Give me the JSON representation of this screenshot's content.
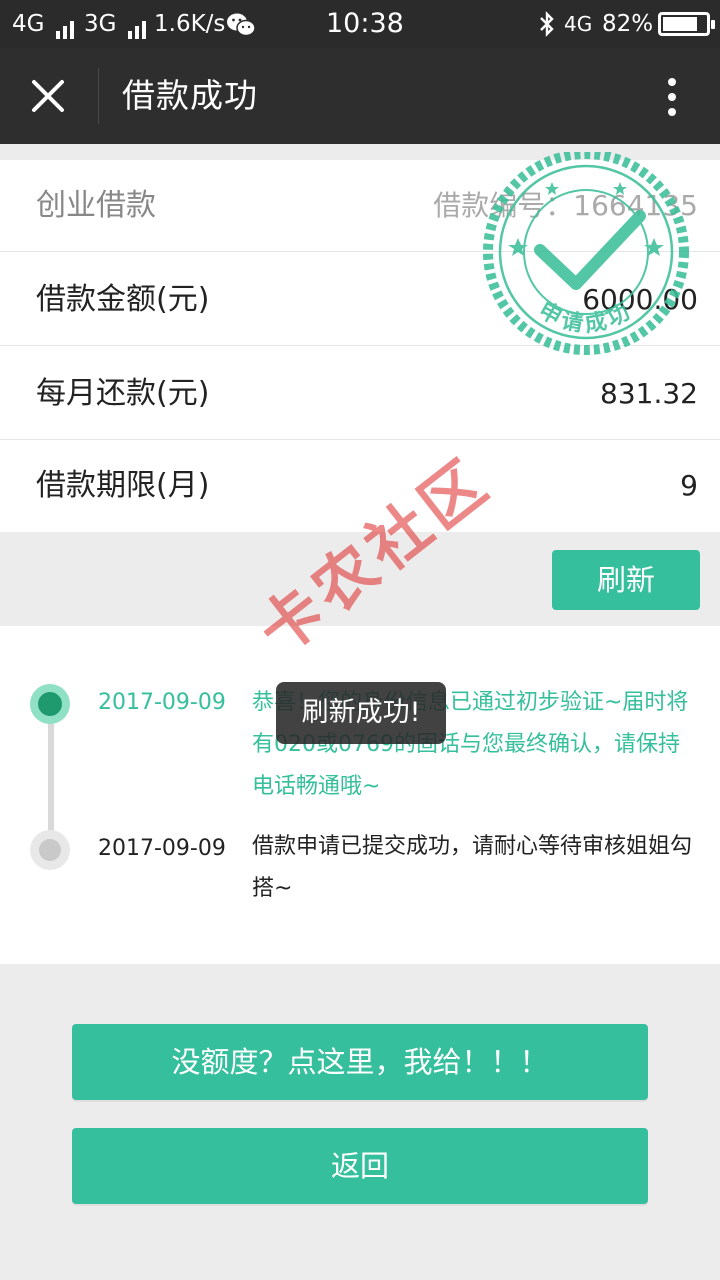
{
  "status_bar": {
    "network1": "4G",
    "network2": "3G",
    "speed": "1.6K/s",
    "time": "10:38",
    "network3": "4G",
    "battery_text": "82%",
    "battery_level": 0.82,
    "icons": [
      "signal-bars-icon",
      "wechat-icon",
      "bluetooth-icon",
      "battery-icon"
    ]
  },
  "title_bar": {
    "title": "借款成功",
    "icons": [
      "close-icon",
      "more-vertical-icon"
    ]
  },
  "info": {
    "product_name": "创业借款",
    "loan_number_text": "借款编号：1664135",
    "rows": [
      {
        "label": "借款金额(元)",
        "value": "6000.00"
      },
      {
        "label": "每月还款(元)",
        "value": "831.32"
      },
      {
        "label": "借款期限(月)",
        "value": "9"
      }
    ]
  },
  "stamp": {
    "text": "申请成功"
  },
  "refresh_button": "刷新",
  "timeline": [
    {
      "date": "2017-09-09",
      "text": "恭喜！您的身份信息已通过初步验证~届时将有020或0769的固话与您最终确认，请保持电话畅通哦~",
      "active": true
    },
    {
      "date": "2017-09-09",
      "text": "借款申请已提交成功，请耐心等待审核姐姐勾搭~",
      "active": false
    }
  ],
  "toast": "刷新成功!",
  "watermark": "卡农社区",
  "buttons": {
    "no_quota": "没额度？点这里，我给！！！",
    "back": "返回"
  },
  "colors": {
    "accent": "#35bf9c",
    "header_bg": "#2e2e2f",
    "page_bg": "#ececec",
    "watermark": "#e23a3a"
  }
}
